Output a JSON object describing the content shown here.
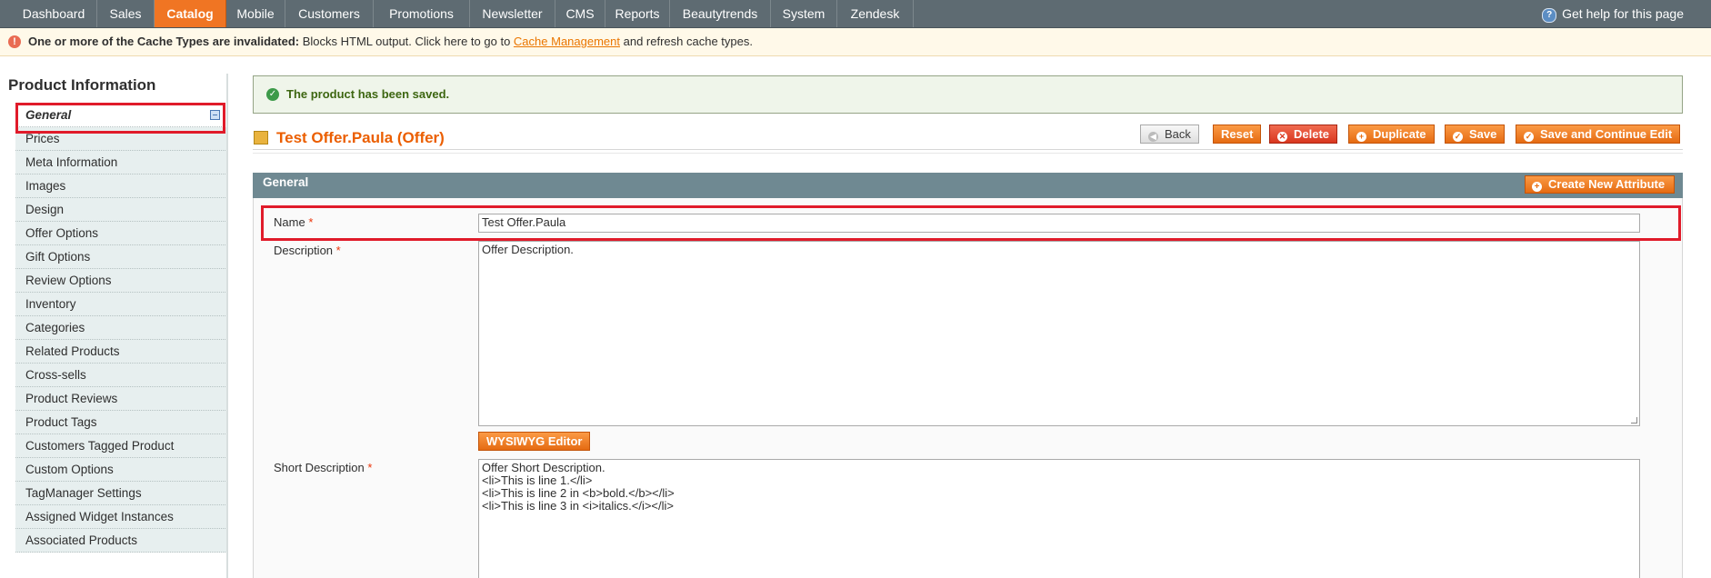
{
  "nav": {
    "items": [
      "Dashboard",
      "Sales",
      "Catalog",
      "Mobile",
      "Customers",
      "Promotions",
      "Newsletter",
      "CMS",
      "Reports",
      "Beautytrends",
      "System",
      "Zendesk"
    ],
    "active": "Catalog",
    "help": "Get help for this page"
  },
  "notice": {
    "bold": "One or more of the Cache Types are invalidated:",
    "text": " Blocks HTML output. Click here to go to ",
    "link": "Cache Management",
    "tail": " and refresh cache types."
  },
  "sidebar": {
    "title": "Product Information",
    "tabs": [
      "General",
      "Prices",
      "Meta Information",
      "Images",
      "Design",
      "Offer Options",
      "Gift Options",
      "Review Options",
      "Inventory",
      "Categories",
      "Related Products",
      "Cross-sells",
      "Product Reviews",
      "Product Tags",
      "Customers Tagged Product",
      "Custom Options",
      "TagManager Settings",
      "Assigned Widget Instances",
      "Associated Products"
    ],
    "active": "General"
  },
  "messages": {
    "success": "The product has been saved."
  },
  "page": {
    "title": "Test Offer.Paula (Offer)"
  },
  "buttons": {
    "back": "Back",
    "reset": "Reset",
    "delete": "Delete",
    "duplicate": "Duplicate",
    "save": "Save",
    "save_continue": "Save and Continue Edit"
  },
  "section": {
    "title": "General",
    "create_attribute": "Create New Attribute"
  },
  "form": {
    "name_label": "Name",
    "name_value": "Test Offer.Paula",
    "description_label": "Description",
    "description_value": "Offer Description.",
    "wysiwyg": "WYSIWYG Editor",
    "short_description_label": "Short Description",
    "short_description_value": "Offer Short Description.\n<li>This is line 1.</li>\n<li>This is line 2 in <b>bold.</b></li>\n<li>This is line 3 in <i>italics.</i></li>",
    "required_mark": "*"
  },
  "colors": {
    "accent": "#f07523",
    "nav_bg": "#5e6b72",
    "highlight": "#e01b2a"
  }
}
